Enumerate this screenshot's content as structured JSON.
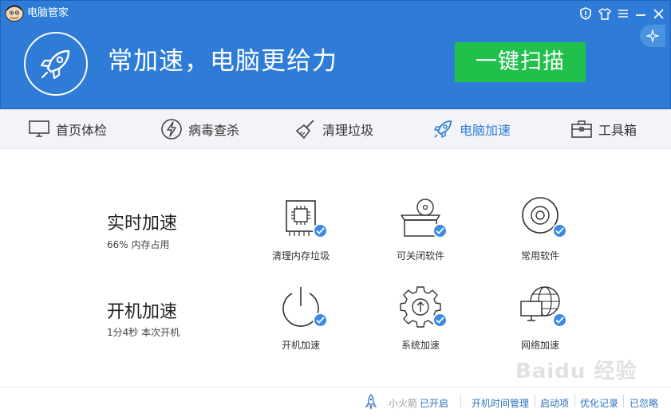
{
  "window": {
    "title": "电脑管家"
  },
  "titlebar_icons": [
    "shield-icon",
    "shirt-icon",
    "menu-icon",
    "minimize-icon",
    "close-icon",
    "sparkle-icon"
  ],
  "hero": {
    "slogan": "常加速，电脑更给力",
    "scan_button": "一键扫描",
    "icon": "rocket-icon"
  },
  "nav": {
    "items": [
      {
        "label": "首页体检",
        "icon": "monitor-icon"
      },
      {
        "label": "病毒查杀",
        "icon": "lightning-icon"
      },
      {
        "label": "清理垃圾",
        "icon": "broom-icon"
      },
      {
        "label": "电脑加速",
        "icon": "rocket-icon",
        "active": true
      },
      {
        "label": "工具箱",
        "icon": "toolbox-icon"
      }
    ]
  },
  "sections": [
    {
      "title": "实时加速",
      "subtitle": "66% 内存占用",
      "features": [
        {
          "label": "清理内存垃圾",
          "icon": "memory-chip-icon",
          "checked": true
        },
        {
          "label": "可关闭软件",
          "icon": "software-box-icon",
          "checked": true
        },
        {
          "label": "常用软件",
          "icon": "disc-icon",
          "checked": true
        }
      ]
    },
    {
      "title": "开机加速",
      "subtitle": "1分4秒 本次开机",
      "features": [
        {
          "label": "开机加速",
          "icon": "power-icon",
          "checked": true
        },
        {
          "label": "系统加速",
          "icon": "gear-icon",
          "checked": true
        },
        {
          "label": "网络加速",
          "icon": "network-icon",
          "checked": true
        }
      ]
    }
  ],
  "footer": {
    "rocket_label": "小火箭",
    "rocket_status": "已开启",
    "links": [
      "开机时间管理",
      "启动项",
      "优化记录",
      "已忽略"
    ]
  },
  "watermark": "Baidu 经验",
  "colors": {
    "header_blue": "#2e7cd8",
    "scan_green": "#21c04a",
    "check_blue": "#3b8be6",
    "nav_bg": "#f2f4f7"
  }
}
